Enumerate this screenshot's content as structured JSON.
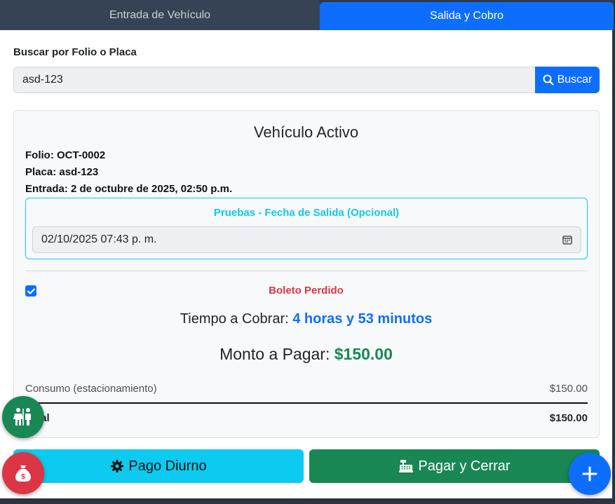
{
  "tabs": {
    "entrada": "Entrada de Vehículo",
    "salida": "Salida y Cobro"
  },
  "search": {
    "label": "Buscar por Folio o Placa",
    "value": "asd-123",
    "button": "Buscar"
  },
  "vehicle": {
    "title": "Vehículo Activo",
    "folio": "Folio: OCT-0002",
    "placa": "Placa: asd-123",
    "entrada": "Entrada: 2 de octubre de 2025, 02:50 p.m."
  },
  "test_section": {
    "title": "Pruebas - Fecha de Salida (Opcional)",
    "date_value": "02/10/2025 07:43  p. m."
  },
  "lost_ticket": {
    "checked": true,
    "label": "Boleto Perdido"
  },
  "billing": {
    "time_label": "Tiempo a Cobrar:",
    "time_value": "4 horas y 53 minutos",
    "amount_label": "Monto a Pagar:",
    "amount_value": "$150.00",
    "consumo_label": "Consumo (estacionamiento)",
    "consumo_value": "$150.00",
    "total_label": "Total",
    "total_value": "$150.00"
  },
  "buttons": {
    "pago_diurno": "Pago Diurno",
    "pagar_cerrar": "Pagar y Cerrar"
  },
  "icons": {
    "search": "search-icon",
    "calendar": "calendar-icon",
    "gear": "gear-icon",
    "cash_register": "cash-register-icon",
    "restroom": "restroom-icon",
    "money_bag": "money-bag-icon",
    "plus": "plus-icon"
  },
  "colors": {
    "primary": "#0d6efd",
    "info": "#0dcaf0",
    "success": "#198754",
    "danger": "#dc3545"
  }
}
